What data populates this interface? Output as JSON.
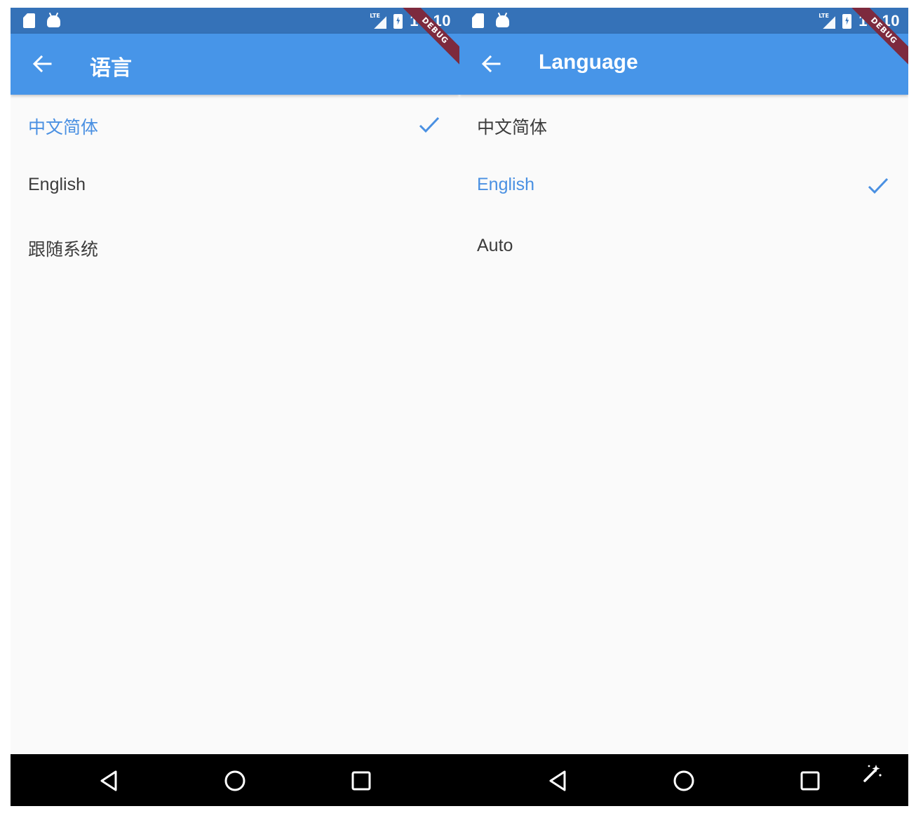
{
  "colors": {
    "status_bar": "#3572b8",
    "app_bar": "#4795e8",
    "selected_text": "#4a90e2",
    "debug_banner": "#7d2a3e",
    "nav_bar": "#000000",
    "background": "#fafafa"
  },
  "screens": [
    {
      "status_bar": {
        "time": "10:10",
        "network": "LTE"
      },
      "debug_banner": "DEBUG",
      "app_bar": {
        "back_icon": "arrow-back-icon",
        "title": "语言"
      },
      "options": [
        {
          "label": "中文简体",
          "selected": true
        },
        {
          "label": "English",
          "selected": false
        },
        {
          "label": "跟随系统",
          "selected": false
        }
      ],
      "nav_bar": [
        "back-triangle-icon",
        "home-circle-icon",
        "recents-square-icon"
      ]
    },
    {
      "status_bar": {
        "time": "10:10",
        "network": "LTE"
      },
      "debug_banner": "DEBUG",
      "app_bar": {
        "back_icon": "arrow-back-icon",
        "title": "Language"
      },
      "options": [
        {
          "label": "中文简体",
          "selected": false
        },
        {
          "label": "English",
          "selected": true
        },
        {
          "label": "Auto",
          "selected": false
        }
      ],
      "nav_bar": [
        "back-triangle-icon",
        "home-circle-icon",
        "recents-square-icon",
        "magic-wand-icon"
      ]
    }
  ]
}
